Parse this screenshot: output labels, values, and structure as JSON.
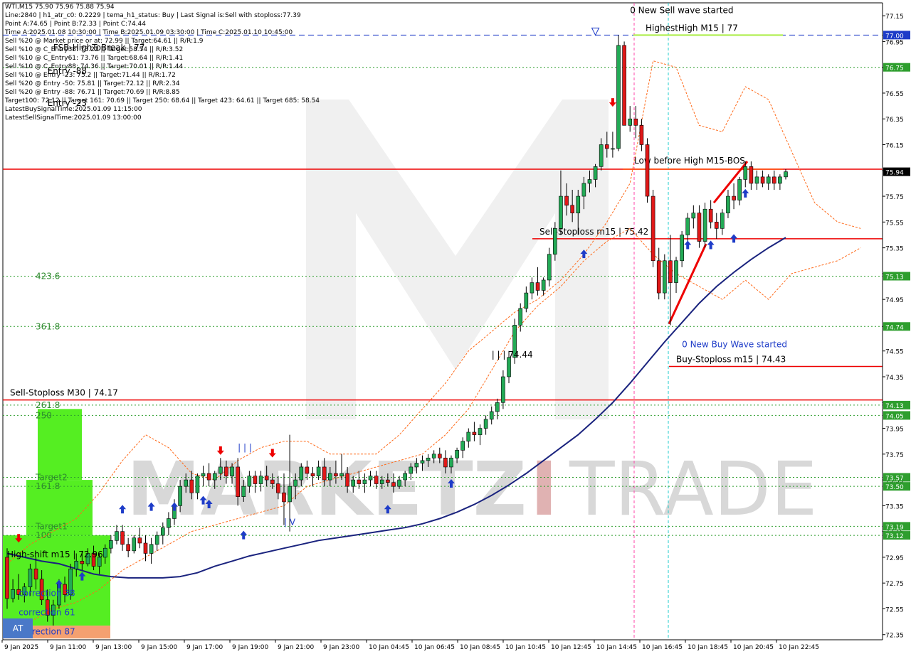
{
  "header": {
    "lines": [
      "WTI,M15  75.90 75.96 75.88 75.94",
      "Line:2840 | h1_atr_c0: 0.2229 | tema_h1_status: Buy | Last Signal is:Sell with stoploss:77.39",
      "Point A:74.65 | Point B:72.33 | Point C:74.44",
      "Time A:2025.01.08 10:30:00 | Time B:2025.01.09 03:30:00 | Time C:2025.01.10 10:45:00",
      "Sell %20 @ Market price or at: 72.99 || Target:64.61 || R/R:1.9",
      "Sell %10 @ C_Entry38: 73.22 || Target:58.54 || R/R:3.52",
      "Sell %10 @ C_Entry61: 73.76 || Target:68.64 || R/R:1.41",
      "Sell %10 @ C_Entry88: 74.36 || Target:70.01 || R/R:1.44",
      "Sell %10 @ Entry -23: 75.2 || Target:71.44 || R/R:1.72",
      "Sell %20 @ Entry -50: 75.81 || Target:72.12 || R/R:2.34",
      "Sell %20 @ Entry -88: 76.71 || Target:70.69 || R/R:8.85",
      "Target100: 72.12 || Target 161: 70.69 || Target 250: 68.64 || Target 423: 64.61 || Target 685: 58.54",
      "LatestBuySignalTime:2025.01.09 11:15:00",
      "LatestSellSignalTime:2025.01.09 13:00:00"
    ]
  },
  "watermark": {
    "left": "MARKETZ",
    "accent": "I",
    "right": "TRADE"
  },
  "at_button": "AT",
  "chart_data": {
    "type": "candlestick",
    "symbol": "WTI",
    "timeframe": "M15",
    "y_ticks": [
      "77.15",
      "76.95",
      "76.75",
      "76.55",
      "76.35",
      "76.15",
      "75.95",
      "75.75",
      "75.55",
      "75.35",
      "75.15",
      "74.95",
      "74.74",
      "74.55",
      "74.35",
      "74.15",
      "73.95",
      "73.75",
      "73.55",
      "73.35",
      "73.15",
      "72.95",
      "72.75",
      "72.55",
      "72.35"
    ],
    "ylim": [
      72.31,
      77.25
    ],
    "x_ticks": [
      "9 Jan 2025",
      "9 Jan 11:00",
      "9 Jan 13:00",
      "9 Jan 15:00",
      "9 Jan 17:00",
      "9 Jan 19:00",
      "9 Jan 21:00",
      "9 Jan 23:00",
      "10 Jan 04:45",
      "10 Jan 06:45",
      "10 Jan 08:45",
      "10 Jan 10:45",
      "10 Jan 12:45",
      "10 Jan 14:45",
      "10 Jan 16:45",
      "10 Jan 18:45",
      "10 Jan 20:45",
      "10 Jan 22:45"
    ],
    "candles": [
      [
        72.95,
        73.02,
        72.55,
        72.63
      ],
      [
        72.63,
        72.78,
        72.6,
        72.7
      ],
      [
        72.7,
        72.82,
        72.62,
        72.66
      ],
      [
        72.66,
        72.75,
        72.6,
        72.72
      ],
      [
        72.72,
        72.9,
        72.65,
        72.86
      ],
      [
        72.86,
        72.95,
        72.7,
        72.78
      ],
      [
        72.78,
        72.85,
        72.58,
        72.62
      ],
      [
        72.62,
        72.7,
        72.45,
        72.5
      ],
      [
        72.5,
        72.62,
        72.42,
        72.58
      ],
      [
        72.58,
        72.78,
        72.55,
        72.74
      ],
      [
        72.74,
        72.8,
        72.6,
        72.66
      ],
      [
        72.66,
        72.9,
        72.62,
        72.86
      ],
      [
        72.86,
        72.98,
        72.8,
        72.92
      ],
      [
        72.92,
        73.0,
        72.85,
        72.9
      ],
      [
        72.9,
        73.02,
        72.88,
        72.98
      ],
      [
        72.98,
        73.04,
        72.85,
        72.88
      ],
      [
        72.88,
        72.98,
        72.82,
        72.95
      ],
      [
        72.95,
        73.05,
        72.9,
        73.02
      ],
      [
        73.02,
        73.12,
        72.98,
        73.08
      ],
      [
        73.08,
        73.2,
        73.05,
        73.15
      ],
      [
        73.15,
        73.2,
        73.0,
        73.05
      ],
      [
        73.05,
        73.1,
        72.95,
        73.0
      ],
      [
        73.0,
        73.12,
        72.98,
        73.1
      ],
      [
        73.1,
        73.18,
        73.02,
        73.06
      ],
      [
        73.06,
        73.12,
        72.92,
        72.98
      ],
      [
        72.98,
        73.1,
        72.9,
        73.05
      ],
      [
        73.05,
        73.15,
        73.0,
        73.12
      ],
      [
        73.12,
        73.22,
        73.05,
        73.18
      ],
      [
        73.18,
        73.3,
        73.12,
        73.25
      ],
      [
        73.25,
        73.4,
        73.2,
        73.35
      ],
      [
        73.35,
        73.55,
        73.3,
        73.5
      ],
      [
        73.5,
        73.6,
        73.45,
        73.55
      ],
      [
        73.55,
        73.62,
        73.4,
        73.45
      ],
      [
        73.45,
        73.6,
        73.4,
        73.58
      ],
      [
        73.58,
        73.66,
        73.5,
        73.6
      ],
      [
        73.6,
        73.68,
        73.5,
        73.55
      ],
      [
        73.55,
        73.62,
        73.48,
        73.6
      ],
      [
        73.6,
        73.72,
        73.55,
        73.65
      ],
      [
        73.65,
        73.7,
        73.52,
        73.58
      ],
      [
        73.58,
        73.68,
        73.52,
        73.65
      ],
      [
        73.65,
        73.72,
        73.35,
        73.42
      ],
      [
        73.42,
        73.55,
        73.38,
        73.5
      ],
      [
        73.5,
        73.62,
        73.45,
        73.58
      ],
      [
        73.58,
        73.62,
        73.45,
        73.52
      ],
      [
        73.52,
        73.62,
        73.46,
        73.58
      ],
      [
        73.58,
        73.66,
        73.5,
        73.55
      ],
      [
        73.55,
        73.6,
        73.48,
        73.52
      ],
      [
        73.52,
        73.58,
        73.4,
        73.45
      ],
      [
        73.45,
        73.6,
        73.2,
        73.38
      ],
      [
        73.38,
        73.9,
        73.15,
        73.5
      ],
      [
        73.5,
        73.6,
        73.4,
        73.55
      ],
      [
        73.55,
        73.68,
        73.5,
        73.65
      ],
      [
        73.65,
        73.7,
        73.55,
        73.6
      ],
      [
        73.6,
        73.65,
        73.5,
        73.58
      ],
      [
        73.58,
        73.7,
        73.55,
        73.65
      ],
      [
        73.65,
        73.72,
        73.5,
        73.55
      ],
      [
        73.55,
        73.65,
        73.5,
        73.6
      ],
      [
        73.6,
        73.7,
        73.52,
        73.58
      ],
      [
        73.58,
        73.75,
        73.55,
        73.6
      ],
      [
        73.6,
        73.65,
        73.45,
        73.5
      ],
      [
        73.5,
        73.58,
        73.45,
        73.55
      ],
      [
        73.55,
        73.62,
        73.48,
        73.52
      ],
      [
        73.52,
        73.6,
        73.45,
        73.55
      ],
      [
        73.55,
        73.62,
        73.5,
        73.58
      ],
      [
        73.58,
        73.62,
        73.48,
        73.52
      ],
      [
        73.52,
        73.58,
        73.48,
        73.55
      ],
      [
        73.55,
        73.6,
        73.5,
        73.53
      ],
      [
        73.53,
        73.6,
        73.45,
        73.5
      ],
      [
        73.5,
        73.58,
        73.48,
        73.55
      ],
      [
        73.55,
        73.62,
        73.5,
        73.6
      ],
      [
        73.6,
        73.68,
        73.55,
        73.65
      ],
      [
        73.65,
        73.72,
        73.6,
        73.68
      ],
      [
        73.68,
        73.74,
        73.62,
        73.7
      ],
      [
        73.7,
        73.75,
        73.65,
        73.72
      ],
      [
        73.72,
        73.78,
        73.68,
        73.75
      ],
      [
        73.75,
        73.8,
        73.68,
        73.72
      ],
      [
        73.72,
        73.78,
        73.6,
        73.65
      ],
      [
        73.65,
        73.74,
        73.6,
        73.72
      ],
      [
        73.72,
        73.8,
        73.68,
        73.78
      ],
      [
        73.78,
        73.88,
        73.72,
        73.85
      ],
      [
        73.85,
        73.95,
        73.8,
        73.92
      ],
      [
        73.92,
        74.0,
        73.85,
        73.9
      ],
      [
        73.9,
        73.98,
        73.82,
        73.95
      ],
      [
        73.95,
        74.05,
        73.9,
        74.02
      ],
      [
        74.02,
        74.12,
        73.98,
        74.08
      ],
      [
        74.08,
        74.18,
        74.02,
        74.15
      ],
      [
        74.15,
        74.4,
        74.1,
        74.35
      ],
      [
        74.35,
        74.55,
        74.3,
        74.5
      ],
      [
        74.5,
        74.8,
        74.45,
        74.75
      ],
      [
        74.75,
        74.92,
        74.7,
        74.88
      ],
      [
        74.88,
        75.05,
        74.85,
        75.0
      ],
      [
        75.0,
        75.12,
        74.95,
        75.08
      ],
      [
        75.08,
        75.2,
        74.98,
        75.02
      ],
      [
        75.02,
        75.12,
        74.98,
        75.1
      ],
      [
        75.1,
        75.35,
        75.05,
        75.3
      ],
      [
        75.3,
        75.55,
        75.25,
        75.5
      ],
      [
        75.5,
        75.95,
        75.45,
        75.75
      ],
      [
        75.75,
        75.85,
        75.6,
        75.68
      ],
      [
        75.68,
        75.8,
        75.55,
        75.62
      ],
      [
        75.62,
        75.8,
        75.45,
        75.75
      ],
      [
        75.75,
        75.9,
        75.65,
        75.85
      ],
      [
        75.85,
        75.95,
        75.78,
        75.88
      ],
      [
        75.88,
        76.0,
        75.82,
        75.98
      ],
      [
        75.98,
        76.2,
        75.95,
        76.15
      ],
      [
        76.15,
        76.25,
        76.05,
        76.12
      ],
      [
        76.12,
        76.25,
        76.05,
        76.12
      ],
      [
        76.12,
        77.0,
        76.1,
        76.92
      ],
      [
        76.92,
        76.95,
        76.3,
        76.3
      ],
      [
        76.3,
        76.45,
        76.25,
        76.35
      ],
      [
        76.35,
        76.45,
        76.2,
        76.3
      ],
      [
        76.3,
        76.35,
        76.1,
        76.15
      ],
      [
        76.15,
        76.2,
        75.7,
        75.75
      ],
      [
        75.75,
        75.8,
        75.2,
        75.25
      ],
      [
        75.25,
        75.35,
        74.95,
        75.0
      ],
      [
        75.0,
        75.3,
        74.95,
        75.25
      ],
      [
        75.25,
        75.45,
        74.75,
        75.08
      ],
      [
        75.08,
        75.28,
        75.0,
        75.25
      ],
      [
        75.25,
        75.48,
        75.2,
        75.45
      ],
      [
        75.45,
        75.62,
        75.38,
        75.58
      ],
      [
        75.58,
        75.68,
        75.5,
        75.62
      ],
      [
        75.62,
        75.68,
        75.35,
        75.4
      ],
      [
        75.4,
        75.7,
        75.35,
        75.65
      ],
      [
        75.65,
        75.72,
        75.5,
        75.55
      ],
      [
        75.55,
        75.62,
        75.42,
        75.5
      ],
      [
        75.5,
        75.65,
        75.45,
        75.62
      ],
      [
        75.62,
        75.8,
        75.58,
        75.75
      ],
      [
        75.75,
        75.85,
        75.65,
        75.72
      ],
      [
        75.72,
        75.9,
        75.68,
        75.88
      ],
      [
        75.88,
        76.02,
        75.82,
        75.98
      ],
      [
        75.98,
        76.02,
        75.8,
        75.85
      ],
      [
        75.85,
        75.95,
        75.8,
        75.9
      ],
      [
        75.9,
        75.95,
        75.82,
        75.85
      ],
      [
        75.85,
        75.92,
        75.8,
        75.9
      ],
      [
        75.9,
        75.95,
        75.8,
        75.85
      ],
      [
        75.85,
        75.92,
        75.8,
        75.9
      ],
      [
        75.9,
        75.96,
        75.88,
        75.94
      ]
    ],
    "horizontal_lines": [
      {
        "price": 77.0,
        "label": "HighestHigh   M15 | 77",
        "style": "blue-dash"
      },
      {
        "price": 76.75,
        "style": "green-dot"
      },
      {
        "price": 75.96,
        "label": "Low before High   M15-BOS",
        "style": "red"
      },
      {
        "price": 75.42,
        "label": "Sell-Stoploss m15 | 75.42",
        "style": "red"
      },
      {
        "price": 75.13,
        "label": "423.6",
        "style": "green-dot"
      },
      {
        "price": 74.74,
        "label": "361.8",
        "style": "green-dot"
      },
      {
        "price": 74.43,
        "label": "Buy-Stoploss m15 | 74.43",
        "style": "red"
      },
      {
        "price": 74.17,
        "label": "Sell-Stoploss M30 | 74.17",
        "style": "red"
      },
      {
        "price": 74.13,
        "label": "261.8",
        "style": "green-dot"
      },
      {
        "price": 74.05,
        "label": "250",
        "style": "green-dot"
      },
      {
        "price": 73.57,
        "label": "Target2",
        "style": "green-dot"
      },
      {
        "price": 73.5,
        "label": "161.8",
        "style": "green-dot"
      },
      {
        "price": 73.19,
        "label": "Target1",
        "style": "green-dot"
      },
      {
        "price": 73.12,
        "label": "100",
        "style": "green-dot"
      }
    ],
    "price_badges": [
      {
        "price": 77.0,
        "text": "77.00",
        "color": "#1e3cc8"
      },
      {
        "price": 76.75,
        "text": "76.75",
        "color": "#2e9e2e"
      },
      {
        "price": 75.94,
        "text": "75.94",
        "color": "#000000"
      },
      {
        "price": 75.13,
        "text": "75.13",
        "color": "#2e9e2e"
      },
      {
        "price": 74.74,
        "text": "74.74",
        "color": "#2e9e2e"
      },
      {
        "price": 74.13,
        "text": "74.13",
        "color": "#2e9e2e"
      },
      {
        "price": 74.05,
        "text": "74.05",
        "color": "#2e9e2e"
      },
      {
        "price": 73.57,
        "text": "73.57",
        "color": "#2e9e2e"
      },
      {
        "price": 73.5,
        "text": "73.50",
        "color": "#2e9e2e"
      },
      {
        "price": 73.19,
        "text": "73.19",
        "color": "#2e9e2e"
      },
      {
        "price": 73.12,
        "text": "73.12",
        "color": "#2e9e2e"
      }
    ],
    "annotations": [
      {
        "text": "0 New Sell wave started",
        "price": 77.17,
        "bar": 108,
        "color": "#000"
      },
      {
        "text": "0 New Buy Wave started",
        "price": 74.58,
        "bar": 117,
        "color": "#1e3cc8"
      },
      {
        "text": "| | | 74.44",
        "price": 74.5,
        "bar": 84,
        "color": "#000"
      },
      {
        "text": "High-shift m15 | 72.96",
        "price": 72.95,
        "bar": 0,
        "color": "#000"
      },
      {
        "text": "correction 38",
        "price": 72.65,
        "bar": 2,
        "color": "#1e3cc8"
      },
      {
        "text": "correction 61",
        "price": 72.5,
        "bar": 2,
        "color": "#1e3cc8"
      },
      {
        "text": "correction 87",
        "price": 72.35,
        "bar": 2,
        "color": "#1e3cc8"
      },
      {
        "text": "| | |",
        "price": 73.78,
        "bar": 40,
        "color": "#1e3cc8"
      },
      {
        "text": "| V",
        "price": 73.2,
        "bar": 48,
        "color": "#1e3cc8"
      },
      {
        "text": "FSB-HighToBreak | 77",
        "price": 76.88,
        "bar": 8,
        "color": "#000"
      },
      {
        "text": "Entry -88",
        "price": 76.7,
        "bar": 7,
        "color": "#000"
      },
      {
        "text": "Entry -23",
        "price": 76.45,
        "bar": 7,
        "color": "#000"
      }
    ],
    "legend": "none",
    "grid": false
  }
}
